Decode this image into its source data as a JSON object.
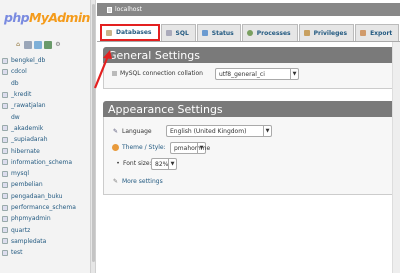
{
  "nav": {
    "logo_php": "php",
    "logo_myadmin": "MyAdmin",
    "quicklinks": [
      "home-icon",
      "exit-icon",
      "query-icon",
      "docs-icon",
      "settings-icon"
    ],
    "databases": [
      {
        "name": "bengkel_db",
        "sub": false
      },
      {
        "name": "cdcol",
        "sub": false
      },
      {
        "name": "db",
        "sub": true
      },
      {
        "name": "_kredit",
        "sub": false
      },
      {
        "name": "_rawatjalan",
        "sub": false
      },
      {
        "name": "dw",
        "sub": true
      },
      {
        "name": "_akademik",
        "sub": false
      },
      {
        "name": "_supiadarah",
        "sub": false
      },
      {
        "name": "hibernate",
        "sub": false
      },
      {
        "name": "information_schema",
        "sub": false
      },
      {
        "name": "mysql",
        "sub": false
      },
      {
        "name": "pembelian",
        "sub": false
      },
      {
        "name": "pengadaan_buku",
        "sub": false
      },
      {
        "name": "performance_schema",
        "sub": false
      },
      {
        "name": "phpmyadmin",
        "sub": false
      },
      {
        "name": "quartz",
        "sub": false
      },
      {
        "name": "sampledata",
        "sub": false
      },
      {
        "name": "test",
        "sub": false
      }
    ]
  },
  "server_bar": {
    "label": "localhost"
  },
  "tabs": [
    {
      "label": "Databases",
      "active": true
    },
    {
      "label": "SQL",
      "active": false
    },
    {
      "label": "Status",
      "active": false
    },
    {
      "label": "Processes",
      "active": false
    },
    {
      "label": "Privileges",
      "active": false
    },
    {
      "label": "Export",
      "active": false
    }
  ],
  "general_settings": {
    "title": "General Settings",
    "collation_label": "MySQL connection collation",
    "collation_value": "utf8_general_ci"
  },
  "appearance_settings": {
    "title": "Appearance Settings",
    "language_label": "Language",
    "language_value": "English (United Kingdom)",
    "theme_label": "Theme / Style:",
    "theme_value": "pmahomme",
    "fontsize_label": "Font size:",
    "fontsize_value": "82%",
    "more_settings": "More settings"
  },
  "colors": {
    "highlight": "#e32020",
    "section_header": "#7a7a7a",
    "link": "#235a81",
    "logo_php": "#7a8be0",
    "logo_myadmin": "#f49b1b"
  }
}
